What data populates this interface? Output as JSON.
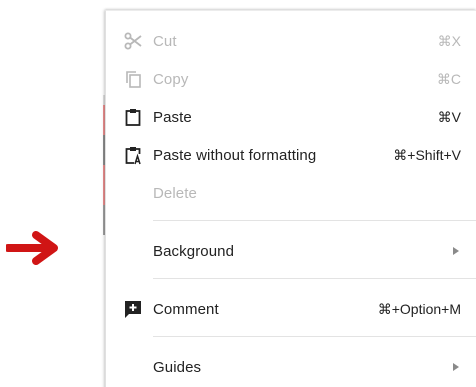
{
  "menu": {
    "items": [
      {
        "label": "Cut",
        "shortcut": "⌘X",
        "icon": "scissors-icon",
        "enabled": false
      },
      {
        "label": "Copy",
        "shortcut": "⌘C",
        "icon": "copy-icon",
        "enabled": false
      },
      {
        "label": "Paste",
        "shortcut": "⌘V",
        "icon": "clipboard-icon",
        "enabled": true
      },
      {
        "label": "Paste without formatting",
        "shortcut": "⌘+Shift+V",
        "icon": "clipboard-text-icon",
        "enabled": true
      },
      {
        "label": "Delete",
        "shortcut": "",
        "icon": "",
        "enabled": false
      },
      {
        "label": "Background",
        "shortcut": "",
        "icon": "",
        "enabled": true,
        "submenu": true
      },
      {
        "label": "Comment",
        "shortcut": "⌘+Option+M",
        "icon": "add-comment-icon",
        "enabled": true
      },
      {
        "label": "Guides",
        "shortcut": "",
        "icon": "",
        "enabled": true,
        "submenu": true
      }
    ]
  },
  "colors": {
    "pointer_arrow": "#d01515",
    "disabled_text": "#b8b8b8",
    "text": "#222222"
  }
}
